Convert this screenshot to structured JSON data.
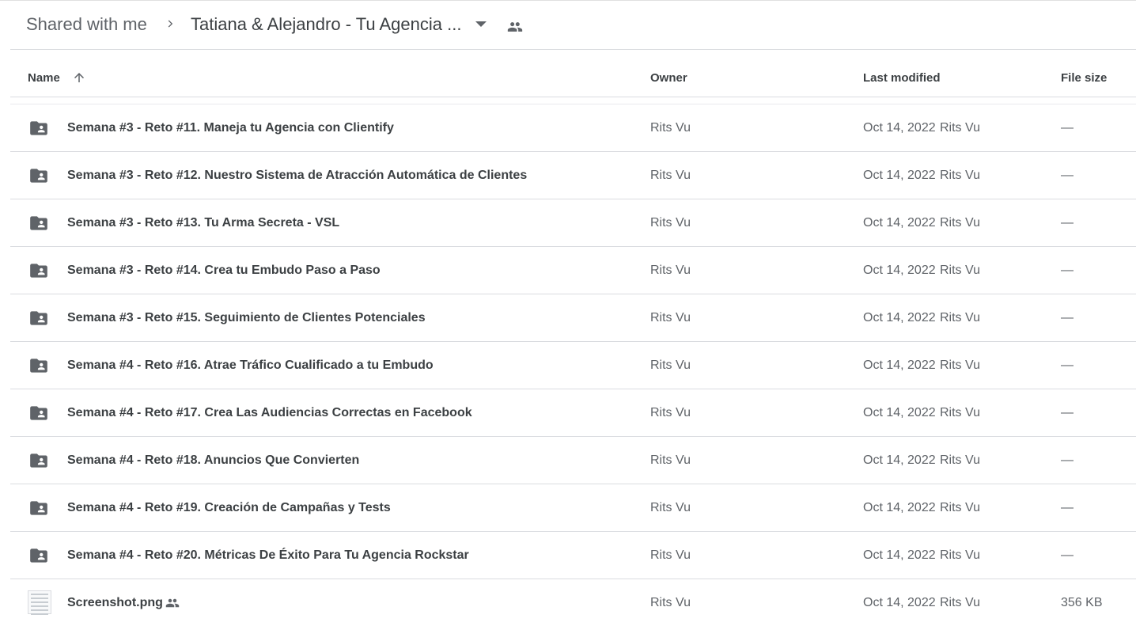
{
  "breadcrumb": {
    "root": "Shared with me",
    "current": "Tatiana & Alejandro - Tu Agencia ..."
  },
  "icons": {
    "chevron": "chevron-right-icon",
    "dropdown": "arrow-drop-down-icon",
    "shared": "people-icon",
    "sort": "arrow-upward-icon",
    "folder": "shared-folder-icon",
    "image": "image-file-icon"
  },
  "columns": {
    "name": "Name",
    "owner": "Owner",
    "modified": "Last modified",
    "size": "File size"
  },
  "rows": [
    {
      "name": "Semana #3 - Reto #11. Maneja tu Agencia con Clientify",
      "owner": "Rits Vu",
      "date": "Oct 14, 2022",
      "by": "Rits Vu",
      "size": "—",
      "type": "folder"
    },
    {
      "name": "Semana #3 - Reto #12. Nuestro Sistema de Atracción Automática de Clientes",
      "owner": "Rits Vu",
      "date": "Oct 14, 2022",
      "by": "Rits Vu",
      "size": "—",
      "type": "folder"
    },
    {
      "name": "Semana #3 - Reto #13. Tu Arma Secreta - VSL",
      "owner": "Rits Vu",
      "date": "Oct 14, 2022",
      "by": "Rits Vu",
      "size": "—",
      "type": "folder"
    },
    {
      "name": "Semana #3 - Reto #14. Crea tu Embudo Paso a Paso",
      "owner": "Rits Vu",
      "date": "Oct 14, 2022",
      "by": "Rits Vu",
      "size": "—",
      "type": "folder"
    },
    {
      "name": "Semana #3 - Reto #15. Seguimiento de Clientes Potenciales",
      "owner": "Rits Vu",
      "date": "Oct 14, 2022",
      "by": "Rits Vu",
      "size": "—",
      "type": "folder"
    },
    {
      "name": "Semana #4 - Reto #16. Atrae Tráfico Cualificado a tu Embudo",
      "owner": "Rits Vu",
      "date": "Oct 14, 2022",
      "by": "Rits Vu",
      "size": "—",
      "type": "folder"
    },
    {
      "name": "Semana #4 - Reto #17. Crea Las Audiencias Correctas en Facebook",
      "owner": "Rits Vu",
      "date": "Oct 14, 2022",
      "by": "Rits Vu",
      "size": "—",
      "type": "folder"
    },
    {
      "name": "Semana #4 - Reto #18. Anuncios Que Convierten",
      "owner": "Rits Vu",
      "date": "Oct 14, 2022",
      "by": "Rits Vu",
      "size": "—",
      "type": "folder"
    },
    {
      "name": "Semana #4 - Reto #19. Creación de Campañas y Tests",
      "owner": "Rits Vu",
      "date": "Oct 14, 2022",
      "by": "Rits Vu",
      "size": "—",
      "type": "folder"
    },
    {
      "name": "Semana #4 - Reto #20. Métricas De Éxito Para Tu Agencia Rockstar",
      "owner": "Rits Vu",
      "date": "Oct 14, 2022",
      "by": "Rits Vu",
      "size": "—",
      "type": "folder"
    },
    {
      "name": "Screenshot.png",
      "owner": "Rits Vu",
      "date": "Oct 14, 2022",
      "by": "Rits Vu",
      "size": "356 KB",
      "type": "image"
    }
  ]
}
